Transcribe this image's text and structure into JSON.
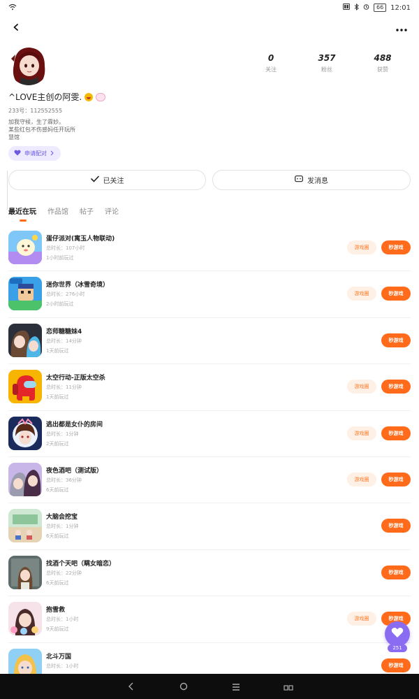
{
  "status": {
    "time": "12:01",
    "battery": "66"
  },
  "profile": {
    "nickname": "^LOVE主创の阿雯.",
    "uid": "233号：112552555",
    "bio_lines": [
      "加我守候，生了霖妙。",
      "某些红包不伤感妈任开玩所",
      "慧馆"
    ],
    "pair_label": "申请配对",
    "stats": [
      {
        "num": "0",
        "label": "关注"
      },
      {
        "num": "357",
        "label": "粉丝"
      },
      {
        "num": "488",
        "label": "获赞"
      }
    ]
  },
  "actions": {
    "follow_label": "已关注",
    "message_label": "发消息"
  },
  "tabs": [
    "最近在玩",
    "作品馆",
    "帖子",
    "评论"
  ],
  "row_buttons": {
    "circle": "游戏圈",
    "play": "秒游戏"
  },
  "games": [
    {
      "name": "蛋仔派对(寓玉人物联动)",
      "time": "总时长：107小时",
      "last": "1小时前玩过",
      "has_circle": true
    },
    {
      "name": "迷你世界（冰雪奇境）",
      "time": "总时长：276小时",
      "last": "2小时前玩过",
      "has_circle": true
    },
    {
      "name": "恋师糖糖妹4",
      "time": "总时长：14分钟",
      "last": "1天前玩过",
      "has_circle": false
    },
    {
      "name": "太空行动-正版太空杀",
      "time": "总时长：11分钟",
      "last": "1天前玩过",
      "has_circle": true
    },
    {
      "name": "逃出都是女仆的房间",
      "time": "总时长：1分钟",
      "last": "2天前玩过",
      "has_circle": true
    },
    {
      "name": "夜色酒吧（测试版）",
      "time": "总时长：36分钟",
      "last": "6天前玩过",
      "has_circle": true
    },
    {
      "name": "大脑会挖宝",
      "time": "总时长：1分钟",
      "last": "6天前玩过",
      "has_circle": false
    },
    {
      "name": "找酒个天吧（瞒女暗恋）",
      "time": "总时长：22分钟",
      "last": "6天前玩过",
      "has_circle": false
    },
    {
      "name": "抱雪救",
      "time": "总时长：1小时",
      "last": "9天前玩过",
      "has_circle": true
    },
    {
      "name": "北斗万国",
      "time": "总时长：1小时",
      "last": "",
      "has_circle": false
    }
  ],
  "fab": {
    "count": "251"
  }
}
